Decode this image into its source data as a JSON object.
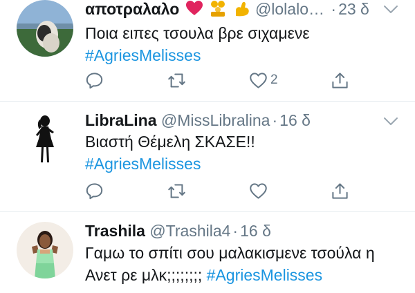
{
  "tweets": [
    {
      "display_name": "αποτραλαλο",
      "handle": "@lolalo…",
      "separator": "·",
      "time": "23 δ",
      "text": "Ποια ειπες τσουλα βρε σιχαμενε",
      "hashtag": "#AgriesMelisses",
      "reply_count": "",
      "retweet_count": "",
      "like_count": "2",
      "name_emojis": [
        "red-heart",
        "family-emoji",
        "flexed-biceps-emoji"
      ]
    },
    {
      "display_name": "LibraLina",
      "handle": "@MissLibralina",
      "separator": "·",
      "time": "16 δ",
      "text": "Βιαστή Θέμελη ΣΚΑΣΕ!!",
      "hashtag": "#AgriesMelisses",
      "reply_count": "",
      "retweet_count": "",
      "like_count": ""
    },
    {
      "display_name": "Trashila",
      "handle": "@Trashila4",
      "separator": "·",
      "time": "16 δ",
      "text_line1": "Γαμω το σπίτι σου μαλακισμενε τσούλα η",
      "text_line2": "Ανετ ρε μλκ;;;;;;;;",
      "hashtag": "#AgriesMelisses"
    }
  ],
  "colors": {
    "link": "#1b95e0",
    "secondary": "#657786",
    "heart": "#e0245e",
    "divider": "#e6ecf0"
  },
  "icons": [
    "reply-icon",
    "retweet-icon",
    "like-icon",
    "share-icon",
    "chevron-down-icon"
  ]
}
